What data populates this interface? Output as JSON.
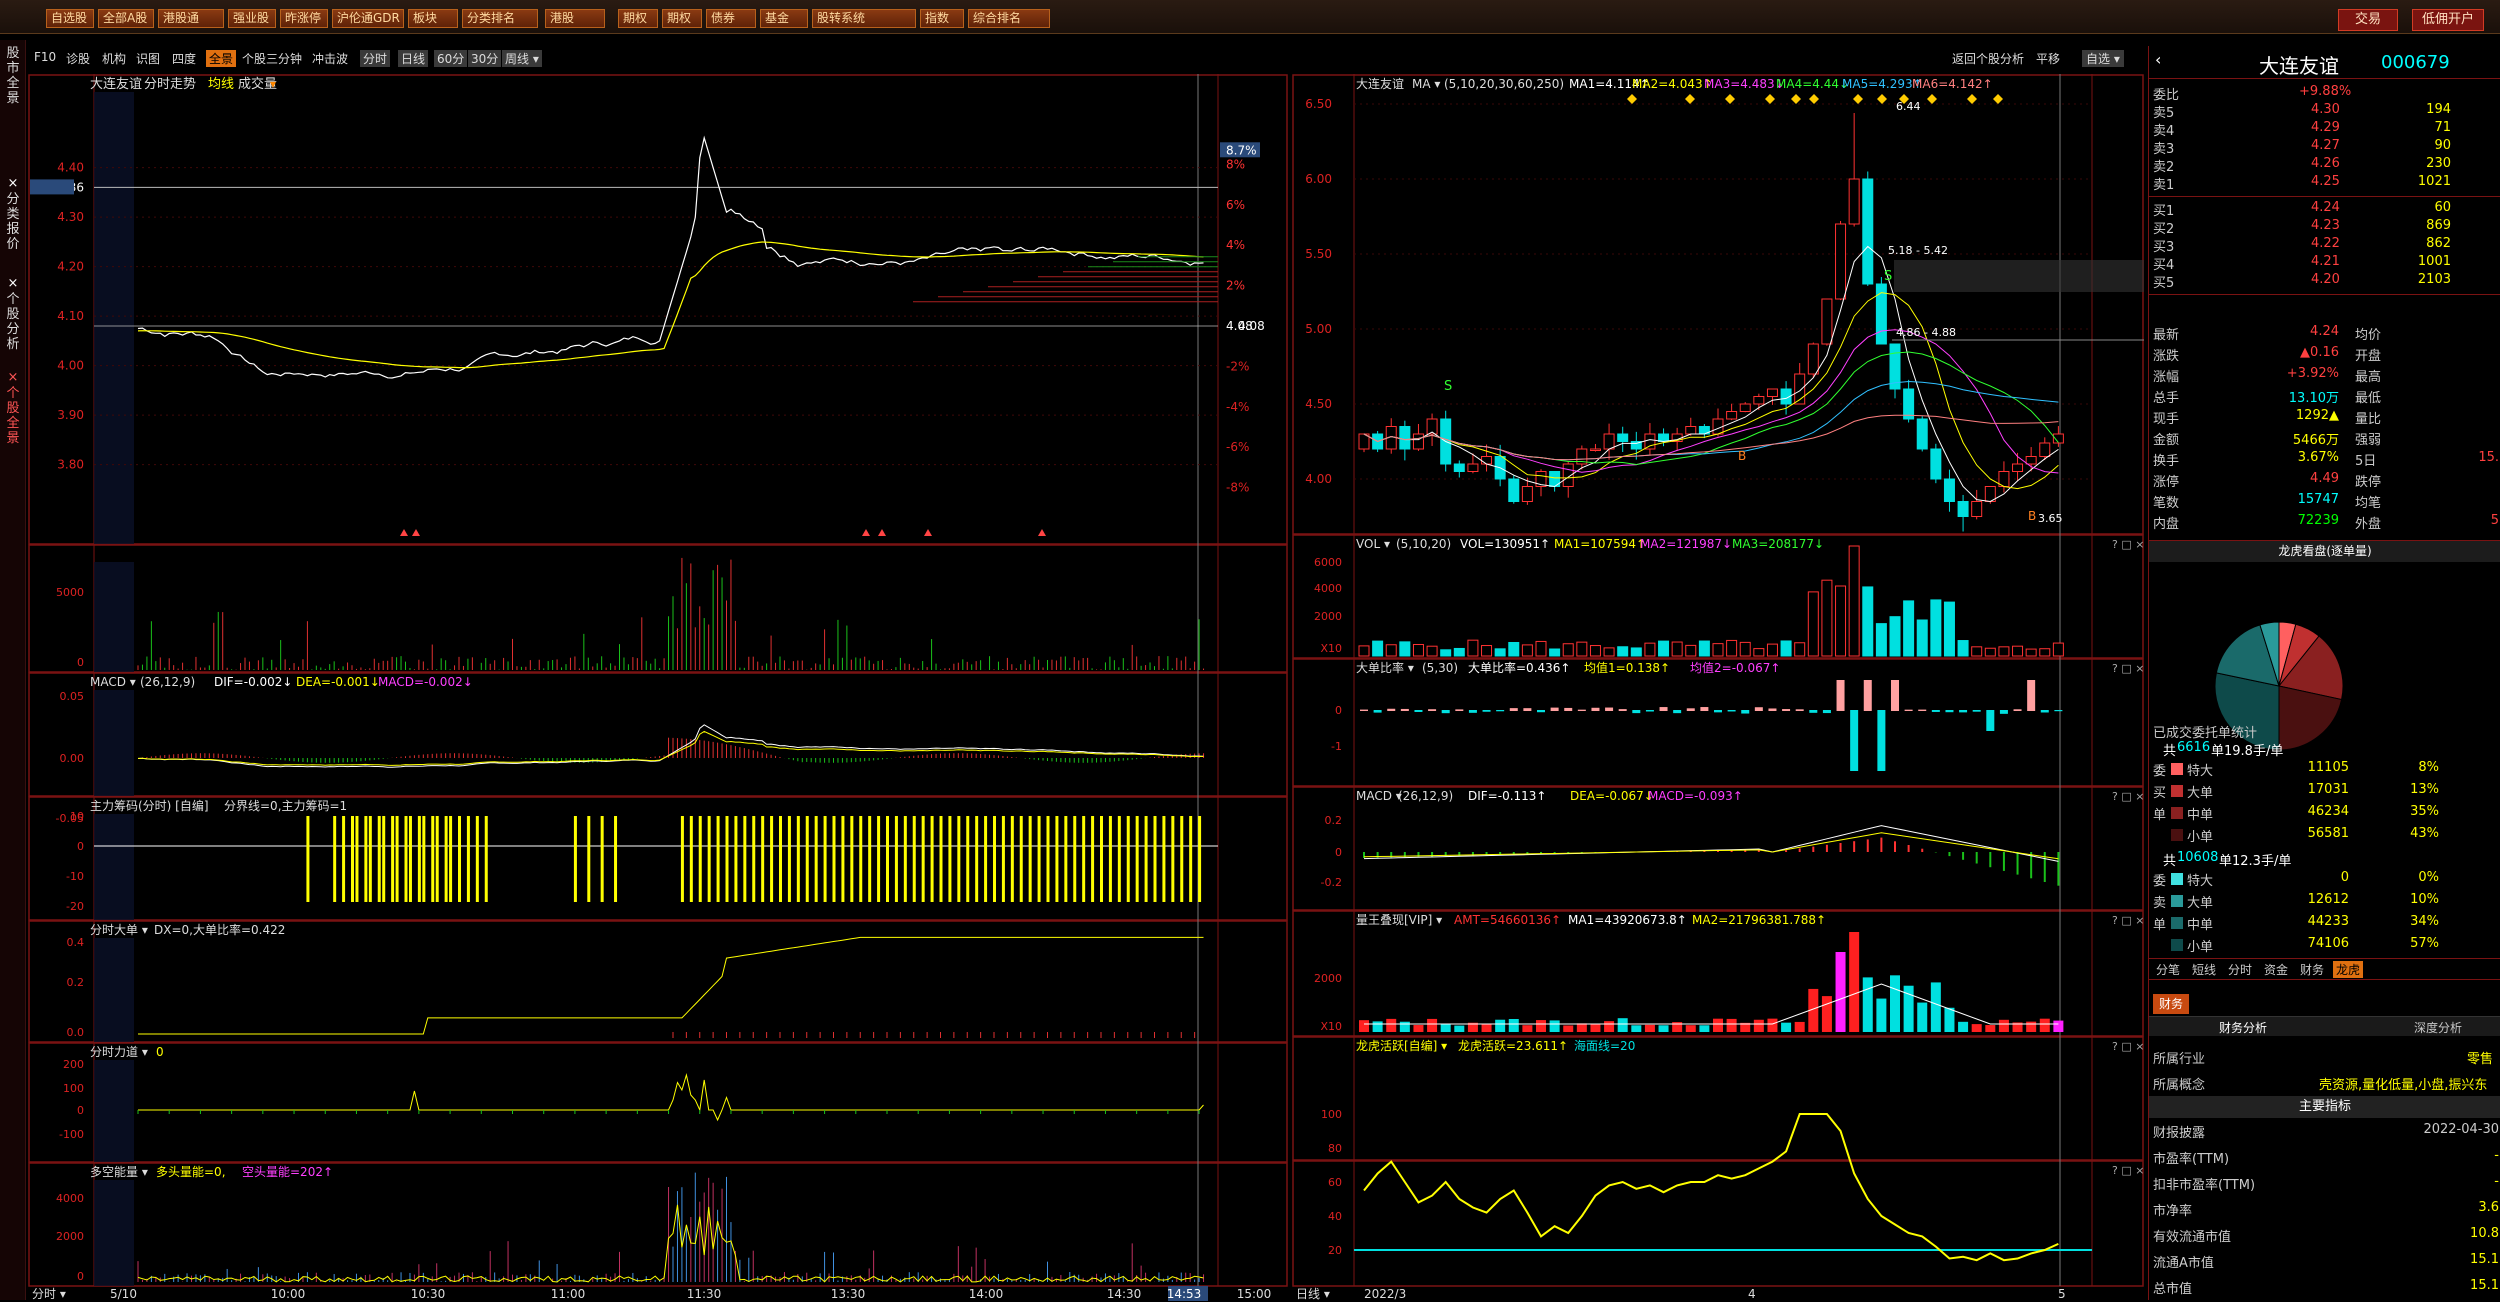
{
  "topbar": {
    "buttons": [
      "自选股",
      "全部A股",
      "港股通",
      "强业股",
      "昨涨停",
      "沪伦通GDR",
      "板块",
      "分类排名",
      "港股",
      "期权",
      "期权",
      "债券",
      "基金",
      "股转系统",
      "指数",
      "综合排名"
    ],
    "trade": "交易",
    "open_account": "低佣开户"
  },
  "left_tabs": [
    "股市全景",
    "分类报价",
    "个股分析",
    "个股全景"
  ],
  "toolbar": {
    "items": [
      "F10",
      "诊股",
      "机构",
      "识图",
      "四度",
      "全景",
      "个股三分钟",
      "冲击波",
      "分时",
      "日线",
      "60分",
      "30分",
      "周线"
    ],
    "right_items": [
      "返回个股分析",
      "平移",
      "自选"
    ]
  },
  "intraday": {
    "title": "大连友谊",
    "sub": "分时走势",
    "avg_label": "均线",
    "vol_label": "成交量",
    "price_ticks": [
      "4.40",
      "4.36",
      "4.30",
      "4.20",
      "4.10",
      "4.00",
      "3.90",
      "3.80"
    ],
    "pct_ticks": [
      "8%",
      "8.7%",
      "6%",
      "4%",
      "2%",
      "4.08",
      "-2%",
      "-4%",
      "-6%",
      "-8%"
    ],
    "vol_ticks": [
      "5000",
      "0"
    ],
    "macd_title": "MACD",
    "macd_params": "(26,12,9)",
    "macd_dif": "DIF=-0.002↓",
    "macd_dea": "DEA=-0.001↓",
    "macd_macd": "MACD=-0.002↓",
    "macd_ticks": [
      "0.05",
      "0.00",
      "-0.05"
    ],
    "zl_title": "主力筹码(分时) [自编]",
    "zl_info": "分界线=0,主力筹码=1",
    "zl_ticks": [
      "10",
      "0",
      "-10",
      "-20"
    ],
    "dd_title": "分时大单",
    "dd_info": "DX=0,大单比率=0.422",
    "dd_ticks": [
      "0.4",
      "0.2",
      "0.0"
    ],
    "ld_title": "分时力道",
    "ld_info": "0",
    "ld_ticks": [
      "200",
      "100",
      "0",
      "-100"
    ],
    "dk_title": "多空能量",
    "dk_info1": "多头量能=0,",
    "dk_info2": "空头量能=202↑",
    "dk_ticks": [
      "4000",
      "2000",
      "0"
    ],
    "time_label": "分时",
    "times": [
      "5/10",
      "10:00",
      "10:30",
      "11:00",
      "11:30",
      "13:30",
      "14:00",
      "14:30",
      "14:53",
      "15:00"
    ]
  },
  "kline": {
    "title": "大连友谊",
    "ma_label": "MA",
    "ma_params": "(5,10,20,30,60,250)",
    "ma": [
      "MA1=4.114↑",
      "MA2=4.043↑",
      "MA3=4.483↓",
      "MA4=4.44↓",
      "MA5=4.293↑",
      "MA6=4.142↑"
    ],
    "price_ticks": [
      "6.50",
      "6.00",
      "5.50",
      "5.00",
      "4.50",
      "4.00"
    ],
    "hi_label": "6.44",
    "lo_label": "3.65",
    "box1": "5.18 - 5.42",
    "box2": "4.86 - 4.88",
    "vol_title": "VOL",
    "vol_params": "(5,10,20)",
    "vol_info": [
      "VOL=130951↑",
      "MA1=107594↑",
      "MA2=121987↓",
      "MA3=208177↓"
    ],
    "vol_ticks": [
      "6000",
      "4000",
      "2000",
      "X10"
    ],
    "dd_title": "大单比率",
    "dd_params": "(5,30)",
    "dd_info": [
      "大单比率=0.436↑",
      "均值1=0.138↑",
      "均值2=-0.067↑"
    ],
    "dd_ticks": [
      "0",
      "-1"
    ],
    "macd_title": "MACD",
    "macd_params": "(26,12,9)",
    "macd_info": [
      "DIF=-0.113↑",
      "DEA=-0.067↓",
      "MACD=-0.093↑"
    ],
    "macd_ticks": [
      "0.2",
      "0",
      "-0.2"
    ],
    "lw_title": "量王叠现[VIP]",
    "lw_info": [
      "AMT=54660136↑",
      "MA1=43920673.8↑",
      "MA2=21796381.788↑"
    ],
    "lw_ticks": [
      "2000",
      "X10"
    ],
    "lh_title": "龙虎活跃[自编]",
    "lh_info": [
      "龙虎活跃=23.611↑",
      "海面线=20"
    ],
    "lh_ticks": [
      "100",
      "80",
      "60",
      "40",
      "20"
    ],
    "x_label": "日线",
    "x_ticks": [
      "2022/3",
      "4",
      "5"
    ]
  },
  "quote": {
    "name": "大连友谊",
    "code": "000679",
    "webi_label": "委比",
    "webi_val": "+9.88%",
    "sells": [
      [
        "卖5",
        "4.30",
        "194"
      ],
      [
        "卖4",
        "4.29",
        "71"
      ],
      [
        "卖3",
        "4.27",
        "90"
      ],
      [
        "卖2",
        "4.26",
        "230"
      ],
      [
        "卖1",
        "4.25",
        "1021"
      ]
    ],
    "buys": [
      [
        "买1",
        "4.24",
        "60"
      ],
      [
        "买2",
        "4.23",
        "869"
      ],
      [
        "买3",
        "4.22",
        "862"
      ],
      [
        "买4",
        "4.21",
        "1001"
      ],
      [
        "买5",
        "4.20",
        "2103"
      ]
    ],
    "stats": [
      [
        "最新",
        "4.24",
        "均价",
        ""
      ],
      [
        "涨跌",
        "▲0.16",
        "开盘",
        ""
      ],
      [
        "涨幅",
        "+3.92%",
        "最高",
        ""
      ],
      [
        "总手",
        "13.10万",
        "最低",
        ""
      ],
      [
        "现手",
        "1292▲",
        "量比",
        ""
      ],
      [
        "金额",
        "5466万",
        "强弱",
        ""
      ],
      [
        "换手",
        "3.67%",
        "5日",
        "15."
      ],
      [
        "涨停",
        "4.49",
        "跌停",
        ""
      ],
      [
        "笔数",
        "15747",
        "均笔",
        ""
      ],
      [
        "内盘",
        "72239",
        "外盘",
        "5"
      ]
    ],
    "pie_title": "龙虎看盘(逐单量)",
    "order_title": "已成交委托单统计",
    "buy_summary1": "共",
    "buy_summary2": "6616",
    "buy_summary3": "单19.8手/单",
    "buy_rows": [
      [
        "特大",
        "11105",
        "8%"
      ],
      [
        "大单",
        "17031",
        "13%"
      ],
      [
        "中单",
        "46234",
        "35%"
      ],
      [
        "小单",
        "56581",
        "43%"
      ]
    ],
    "sell_summary1": "共",
    "sell_summary2": "10608",
    "sell_summary3": "单12.3手/单",
    "sell_rows": [
      [
        "特大",
        "0",
        "0%"
      ],
      [
        "大单",
        "12612",
        "10%"
      ],
      [
        "中单",
        "44233",
        "34%"
      ],
      [
        "小单",
        "74106",
        "57%"
      ]
    ],
    "side_buy": [
      "委",
      "买",
      "单"
    ],
    "side_sell": [
      "委",
      "卖",
      "单"
    ],
    "tabs": [
      "分笔",
      "短线",
      "分时",
      "资金",
      "财务",
      "龙虎"
    ],
    "fin_tab": "财务",
    "fin_sub1": "财务分析",
    "fin_sub2": "深度分析",
    "industry_label": "所属行业",
    "industry_val": "零售",
    "concept_label": "所属概念",
    "concept_val": "壳资源,量化低量,小盘,振兴东",
    "key_title": "主要指标",
    "fin_rows": [
      [
        "财报披露",
        "2022-04-30"
      ],
      [
        "市盈率(TTM)",
        "-"
      ],
      [
        "扣非市盈率(TTM)",
        "-"
      ],
      [
        "市净率",
        "3.6"
      ],
      [
        "有效流通市值",
        "10.8"
      ],
      [
        "流通A市值",
        "15.1"
      ],
      [
        "总市值",
        "15.1"
      ]
    ]
  },
  "colors": {
    "up": "#ff3232",
    "down": "#00e0e0",
    "yellow": "#ffff00",
    "frame": "#7a1212"
  }
}
